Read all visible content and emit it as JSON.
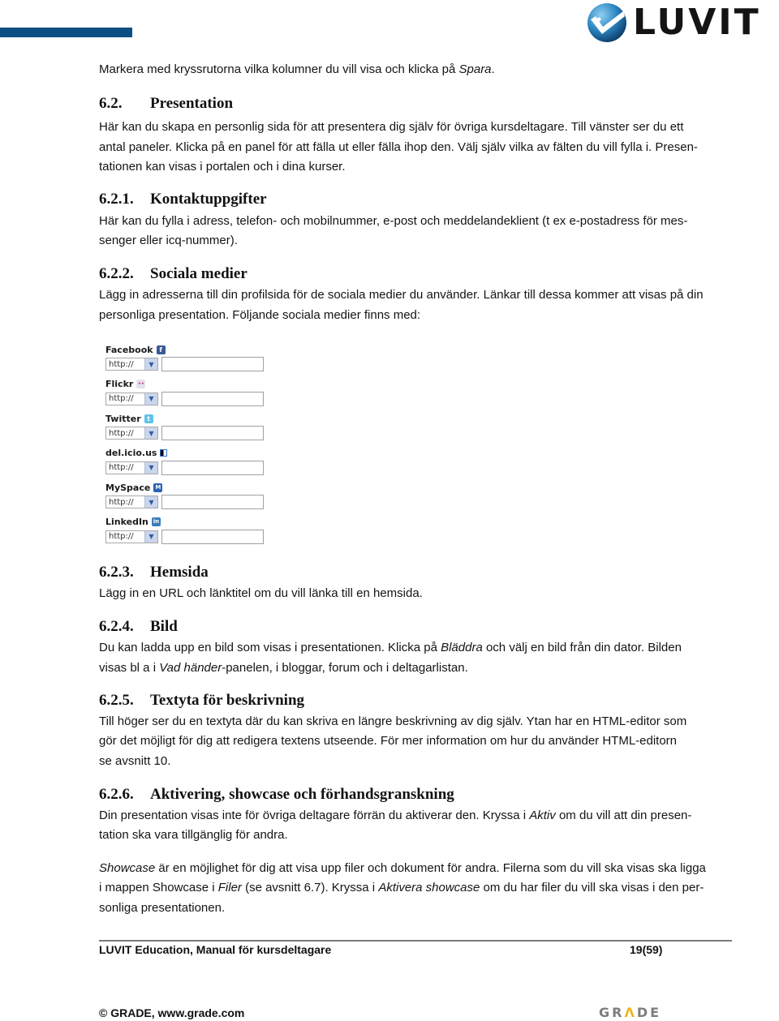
{
  "header": {
    "logo_text": "LUVIT",
    "accent_color": "#0b4f85"
  },
  "intro": {
    "text_before": "Markera med kryssrutorna vilka kolumner du vill visa och klicka på ",
    "italic": "Spara",
    "text_after": "."
  },
  "sections": {
    "s62": {
      "number": "6.2.",
      "title": "Presentation",
      "lines": [
        "Här kan du skapa en personlig sida för att presentera dig själv för övriga kursdeltagare. Till vänster ser du ett",
        "antal paneler. Klicka på en panel för att fälla ut eller fälla ihop den. Välj själv vilka av fälten du vill fylla i. Presen-",
        "tationen kan visas i portalen och i dina kurser."
      ]
    },
    "s621": {
      "number": "6.2.1.",
      "title": "Kontaktuppgifter",
      "lines": [
        "Här kan du fylla i adress, telefon- och mobilnummer, e-post och meddelandeklient (t ex e-postadress för mes-",
        "senger eller icq-nummer)."
      ]
    },
    "s622": {
      "number": "6.2.2.",
      "title": "Sociala medier",
      "lines": [
        "Lägg in adresserna till din profilsida för de sociala medier du använder. Länkar till dessa kommer att visas på din",
        "personliga presentation. Följande sociala medier finns med:"
      ]
    },
    "s623": {
      "number": "6.2.3.",
      "title": "Hemsida",
      "lines": [
        "Lägg in en URL och länktitel om du vill länka till en hemsida."
      ]
    },
    "s624": {
      "number": "6.2.4.",
      "title": "Bild",
      "line1_a": "Du kan ladda upp en bild som visas i presentationen. Klicka på ",
      "line1_i": "Bläddra",
      "line1_b": " och välj en bild från din dator. Bilden",
      "line2_a": "visas bl a i ",
      "line2_i": "Vad händer",
      "line2_b": "-panelen, i bloggar, forum och i deltagarlistan."
    },
    "s625": {
      "number": "6.2.5.",
      "title": "Textyta för beskrivning",
      "lines": [
        "Till höger ser du en textyta där du kan skriva en längre beskrivning av dig själv. Ytan har en HTML-editor som",
        "gör det möjligt för dig att redigera textens utseende. För mer information om hur du använder HTML-editorn",
        "se avsnitt 10."
      ]
    },
    "s626": {
      "number": "6.2.6.",
      "title": "Aktivering, showcase och förhandsgranskning",
      "p1_l1_a": "Din presentation visas inte för övriga deltagare förrän du aktiverar den. Kryssa i ",
      "p1_l1_i": "Aktiv",
      "p1_l1_b": " om du vill att din presen-",
      "p1_l2": "tation ska vara tillgänglig för andra.",
      "p2_l1_i": "Showcase",
      "p2_l1_b": " är en möjlighet för dig att visa upp filer och dokument för andra. Filerna som du vill ska visas ska ligga",
      "p2_l2_a": "i mappen Showcase i ",
      "p2_l2_i1": "Filer",
      "p2_l2_b": " (se avsnitt 6.7). Kryssa i ",
      "p2_l2_i2": "Aktivera showcase",
      "p2_l2_c": " om du har filer du vill ska visas i den per-",
      "p2_l3": "sonliga presentationen."
    }
  },
  "social_media": [
    {
      "label": "Facebook",
      "icon": "facebook-icon",
      "icon_glyph": "f",
      "icon_color": "#3b5998",
      "protocol": "http://",
      "value": ""
    },
    {
      "label": "Flickr",
      "icon": "flickr-icon",
      "icon_glyph": "••",
      "icon_color": "#d9d9e6",
      "protocol": "http://",
      "value": ""
    },
    {
      "label": "Twitter",
      "icon": "twitter-icon",
      "icon_glyph": "t",
      "icon_color": "#5fc3e8",
      "protocol": "http://",
      "value": ""
    },
    {
      "label": "del.icio.us",
      "icon": "delicious-icon",
      "icon_glyph": "",
      "icon_color": "#3274d1",
      "protocol": "http://",
      "value": ""
    },
    {
      "label": "MySpace",
      "icon": "myspace-icon",
      "icon_glyph": "M",
      "icon_color": "#2a62b5",
      "protocol": "http://",
      "value": ""
    },
    {
      "label": "LinkedIn",
      "icon": "linkedin-icon",
      "icon_glyph": "in",
      "icon_color": "#3a7cb8",
      "protocol": "http://",
      "value": ""
    }
  ],
  "footer": {
    "title": "LUVIT Education, Manual för kursdeltagare",
    "page": "19(59)",
    "copyright": "© GRADE, www.grade.com",
    "grade_logo": {
      "g": "GR",
      "a": "Λ",
      "rest": "DE",
      "accent": "#f0b31c"
    }
  }
}
